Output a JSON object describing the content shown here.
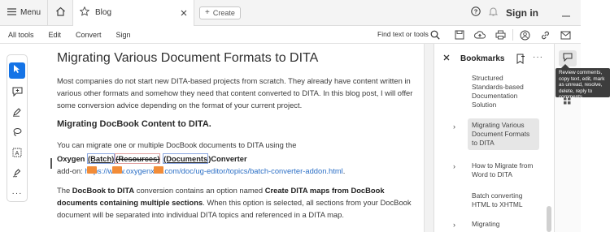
{
  "topbar": {
    "menu_label": "Menu",
    "tab_title": "Blog",
    "create_label": "Create",
    "signin_label": "Sign in"
  },
  "toolbar": {
    "items": [
      "All tools",
      "Edit",
      "Convert",
      "Sign"
    ],
    "find_label": "Find text or tools"
  },
  "document": {
    "title": "Migrating Various Document Formats to DITA",
    "intro": "Most companies do not start new DITA-based projects from scratch. They already have content written in various other formats and somehow they need that content converted to DITA. In this blog post, I will offer some conversion advice depending on the format of your current project.",
    "section_heading": "Migrating DocBook Content to DITA.",
    "para_convert": "You can migrate one or multiple DocBook documents to DITA using the",
    "converter_prefix": "Oxygen ",
    "tracked_batch": "(Batch)",
    "tracked_resources": "(Resources)",
    "tracked_documents": "(Documents",
    "converter_suffix": ")Converter",
    "addon_prefix": "add-on: ",
    "addon_url": "https://www.oxygenxml.com/doc/ug-editor/topics/batch-converter-addon.html",
    "addon_end": ".",
    "para2_a": "The ",
    "para2_b": "DocBook to DITA",
    "para2_c": " conversion contains an option named ",
    "para2_d": "Create DITA maps from DocBook documents containing multiple sections",
    "para2_e": ". When this option is selected, all sections from your DocBook document will be separated into individual DITA topics and referenced in a DITA map."
  },
  "bookmarks": {
    "title": "Bookmarks",
    "items": [
      {
        "label": "Structured Standards-based Documentation Solution",
        "has_children": false,
        "selected": false
      },
      {
        "label": "Migrating Various Document Formats to DITA",
        "has_children": true,
        "selected": true
      },
      {
        "label": "How to Migrate from Word to DITA",
        "has_children": true,
        "selected": false
      },
      {
        "label": "Batch converting HTML to XHTML",
        "has_children": false,
        "selected": false
      },
      {
        "label": "Migrating",
        "has_children": true,
        "selected": false
      }
    ]
  },
  "tooltip": {
    "text": "Review comments, copy text, edit, mark as unread, resolve, delete, reply to comments"
  },
  "colors": {
    "accent": "#1473e6",
    "link": "#2b6fc6",
    "deleted": "#c62828",
    "comment_marker": "#f28c38"
  }
}
